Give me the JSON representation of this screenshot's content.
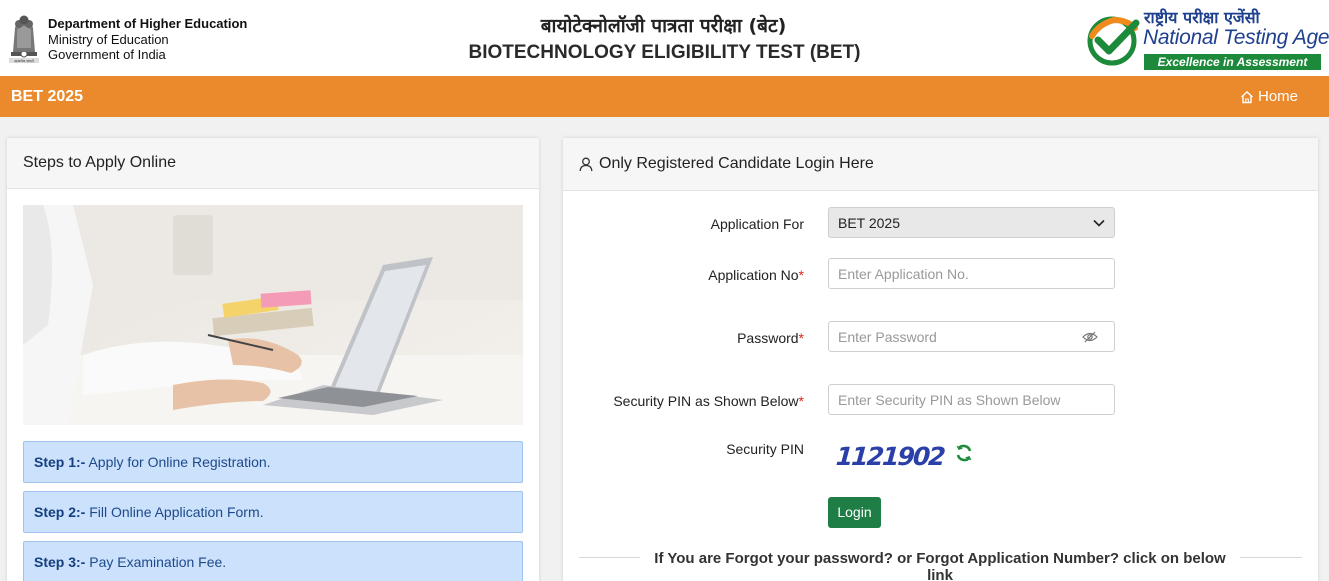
{
  "header": {
    "department": "Department of Higher Education",
    "ministry": "Ministry of Education",
    "government": "Government of India",
    "hindi_title": "बायोटेक्नोलॉजी पात्रता परीक्षा (बेट)",
    "english_title": "BIOTECHNOLOGY ELIGIBILITY TEST (BET)",
    "nta_hindi": "राष्ट्रीय परीक्षा एजेंसी",
    "nta_english": "National Testing Agency",
    "nta_tagline": "Excellence in Assessment"
  },
  "navbar": {
    "title": "BET 2025",
    "home_label": "Home",
    "color": "#ea8a2c"
  },
  "steps_panel": {
    "heading": "Steps to Apply Online",
    "steps": [
      {
        "label": "Step 1:-",
        "text": "Apply for Online Registration."
      },
      {
        "label": "Step 2:-",
        "text": "Fill Online Application Form."
      },
      {
        "label": "Step 3:-",
        "text": "Pay Examination Fee."
      }
    ]
  },
  "login_panel": {
    "heading": "Only Registered Candidate Login Here",
    "application_for_label": "Application For",
    "application_for_value": "BET 2025",
    "application_no_label": "Application No",
    "application_no_placeholder": "Enter Application No.",
    "password_label": "Password",
    "password_placeholder": "Enter Password",
    "security_pin_input_label": "Security PIN as Shown Below",
    "security_pin_placeholder": "Enter Security PIN as Shown Below",
    "security_pin_label": "Security PIN",
    "captcha_value": "1121902",
    "login_button": "Login",
    "forgot_text": "If You are Forgot your password? or Forgot Application Number? click on below link",
    "required_mark": "*",
    "login_color": "#1e7e45"
  }
}
